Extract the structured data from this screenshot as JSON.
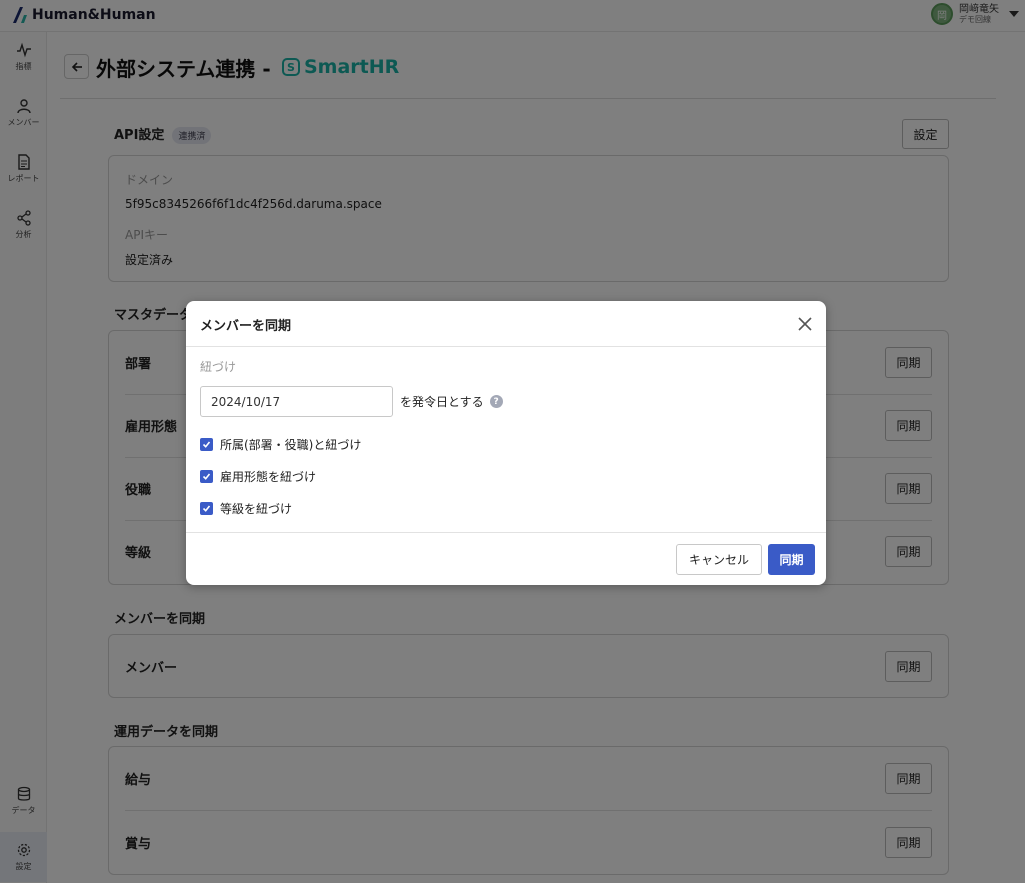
{
  "header": {
    "logo_text": "Human&Human",
    "user_initial": "岡",
    "user_name": "岡﨑竜矢",
    "user_org": "デモ回線"
  },
  "sidebar": {
    "items": [
      {
        "label": "指標",
        "icon": "pulse-icon"
      },
      {
        "label": "メンバー",
        "icon": "person-icon"
      },
      {
        "label": "レポート",
        "icon": "document-icon"
      },
      {
        "label": "分析",
        "icon": "share-icon"
      },
      {
        "label": "データ",
        "icon": "database-icon"
      },
      {
        "label": "設定",
        "icon": "gear-icon"
      }
    ]
  },
  "page": {
    "title": "外部システム連携 -",
    "brand": "SmartHR",
    "brand_mark": "S"
  },
  "api": {
    "title": "API設定",
    "badge": "連携済",
    "settings_button": "設定",
    "domain_label": "ドメイン",
    "domain_value": "5f95c8345266f6f1dc4f256d.daruma.space",
    "key_label": "APIキー",
    "key_value": "設定済み"
  },
  "master": {
    "title": "マスタデータ",
    "rows": [
      {
        "label": "部署",
        "button": "同期"
      },
      {
        "label": "雇用形態",
        "button": "同期"
      },
      {
        "label": "役職",
        "button": "同期"
      },
      {
        "label": "等級",
        "button": "同期"
      }
    ]
  },
  "members": {
    "title": "メンバーを同期",
    "rows": [
      {
        "label": "メンバー",
        "button": "同期"
      }
    ]
  },
  "operation": {
    "title": "運用データを同期",
    "rows": [
      {
        "label": "給与",
        "button": "同期"
      },
      {
        "label": "賞与",
        "button": "同期"
      }
    ]
  },
  "modal": {
    "title": "メンバーを同期",
    "section_label": "紐づけ",
    "date_value": "2024/10/17",
    "date_suffix": "を発令日とする",
    "checks": [
      {
        "label": "所属(部署・役職)と紐づけ",
        "checked": true
      },
      {
        "label": "雇用形態を紐づけ",
        "checked": true
      },
      {
        "label": "等級を紐づけ",
        "checked": true
      }
    ],
    "cancel_label": "キャンセル",
    "confirm_label": "同期"
  },
  "colors": {
    "primary": "#3a5bc7",
    "brand": "#1ab3a6"
  }
}
